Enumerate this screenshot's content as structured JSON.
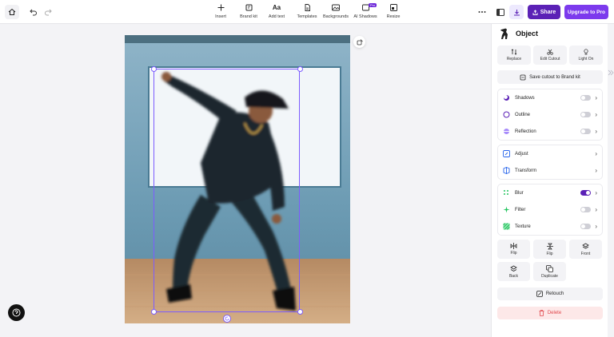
{
  "toolbar": {
    "tools": [
      {
        "label": "Insert",
        "icon": "plus-icon"
      },
      {
        "label": "Brand kit",
        "icon": "brand-kit-icon"
      },
      {
        "label": "Add text",
        "icon": "text-icon",
        "glyph": "Aa"
      },
      {
        "label": "Templates",
        "icon": "templates-icon"
      },
      {
        "label": "Backgrounds",
        "icon": "backgrounds-icon"
      },
      {
        "label": "AI Shadows",
        "icon": "ai-shadows-icon",
        "badge": "Pro"
      },
      {
        "label": "Resize",
        "icon": "resize-icon"
      }
    ],
    "share_label": "Share",
    "upgrade_label": "Upgrade to Pro"
  },
  "panel": {
    "title": "Object",
    "top_actions": [
      "Replace",
      "Edit Cutout",
      "Light On"
    ],
    "save_cutout_label": "Save cutout to Brand kit",
    "effects": [
      {
        "label": "Shadows",
        "on": false
      },
      {
        "label": "Outline",
        "on": false
      },
      {
        "label": "Reflection",
        "on": false
      }
    ],
    "adjust": [
      {
        "label": "Adjust"
      },
      {
        "label": "Transform"
      }
    ],
    "filters": [
      {
        "label": "Blur",
        "on": true
      },
      {
        "label": "Filter",
        "on": false
      },
      {
        "label": "Texture",
        "on": false
      }
    ],
    "arrange": [
      "Flip",
      "Flip",
      "Front",
      "Back",
      "Duplicate"
    ],
    "retouch_label": "Retouch",
    "delete_label": "Delete"
  },
  "colors": {
    "accent": "#5b21b6",
    "upgrade": "#7c3aed",
    "selection": "#7c5cff",
    "delete_text": "#e0474c"
  }
}
